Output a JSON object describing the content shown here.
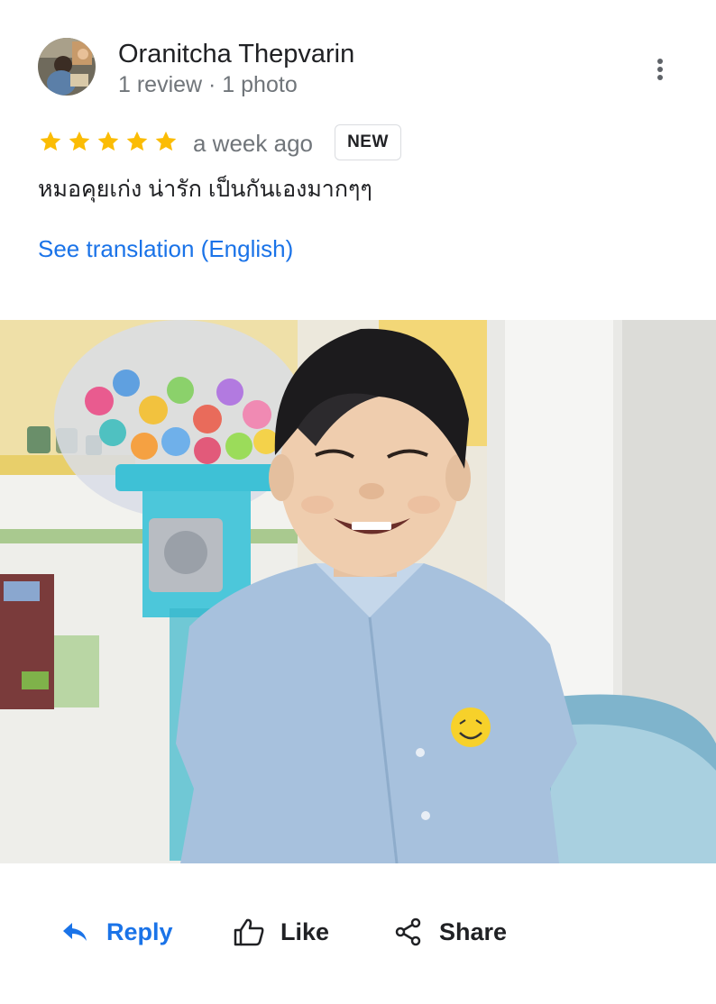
{
  "reviewer": {
    "name": "Oranitcha Thepvarin",
    "meta": "1 review · 1 photo"
  },
  "review": {
    "rating": 5,
    "time_ago": "a week ago",
    "badge": "NEW",
    "text": "หมอคุยเก่ง น่ารัก เป็นกันเองมากๆๆ",
    "translate_link": "See translation (English)"
  },
  "actions": {
    "reply": "Reply",
    "like": "Like",
    "share": "Share"
  },
  "colors": {
    "star": "#fbbc04",
    "link": "#1a73e8",
    "secondary_text": "#70757a",
    "primary_text": "#202124"
  },
  "icons": {
    "more": "more-vertical-icon",
    "star": "star-icon",
    "reply": "reply-arrow-icon",
    "like": "thumbs-up-icon",
    "share": "share-icon"
  }
}
